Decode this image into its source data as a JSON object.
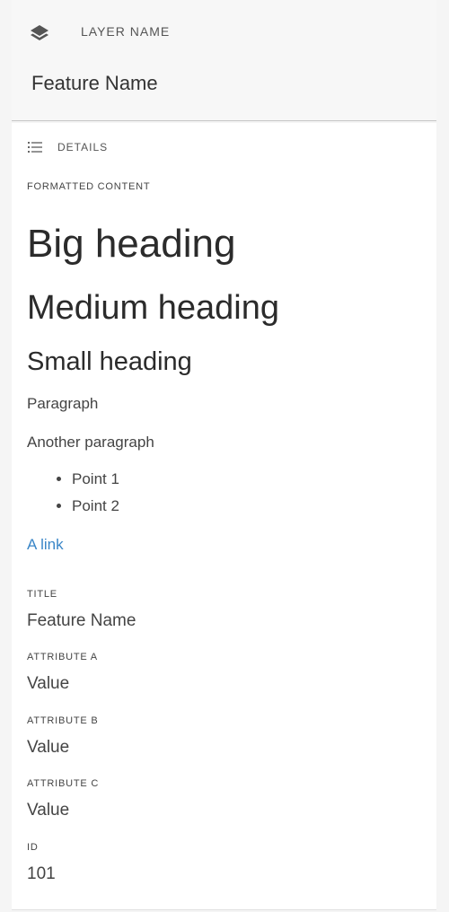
{
  "header": {
    "layer_icon": "layers-icon",
    "layer_name": "LAYER NAME",
    "feature_title": "Feature Name"
  },
  "panel": {
    "details_icon": "list-icon",
    "details_label": "DETAILS",
    "formatted_content_label": "FORMATTED CONTENT",
    "content": {
      "big_heading": "Big heading",
      "medium_heading": "Medium heading",
      "small_heading": "Small heading",
      "paragraph_1": "Paragraph",
      "paragraph_2": "Another paragraph",
      "points": [
        "Point 1",
        "Point 2"
      ],
      "link": "A link",
      "link_color": "#3a86c7"
    },
    "attributes": [
      {
        "label": "TITLE",
        "value": "Feature Name"
      },
      {
        "label": "ATTRIBUTE A",
        "value": "Value"
      },
      {
        "label": "ATTRIBUTE B",
        "value": "Value"
      },
      {
        "label": "ATTRIBUTE C",
        "value": "Value"
      },
      {
        "label": "ID",
        "value": "101"
      }
    ]
  }
}
